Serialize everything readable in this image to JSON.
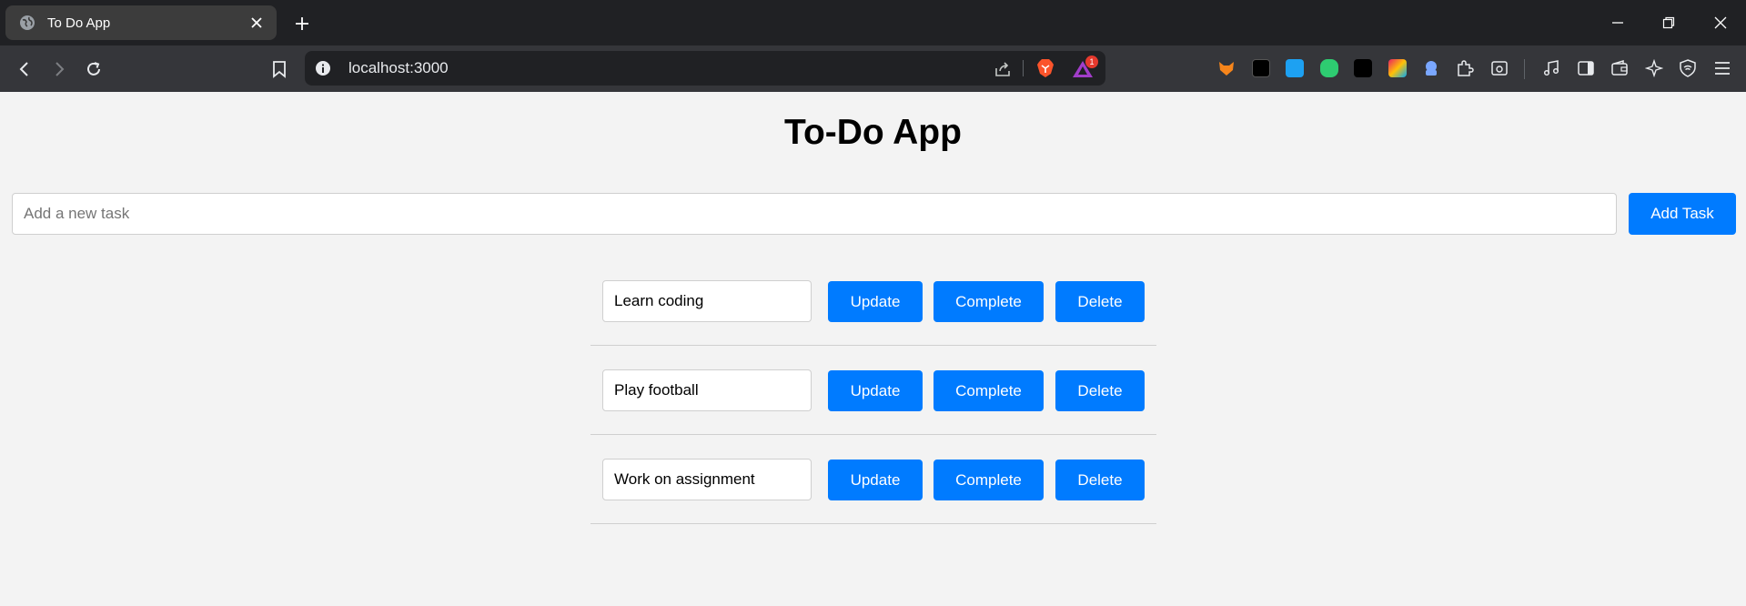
{
  "browser": {
    "tab_title": "To Do App",
    "url": "localhost:3000",
    "rewards_badge": "1",
    "icons": [
      "globe-icon",
      "close-icon",
      "plus-icon",
      "back-icon",
      "forward-icon",
      "reload-icon",
      "bookmark-icon",
      "info-icon",
      "share-icon",
      "brave-shield-icon",
      "brave-rewards-icon",
      "minimize-icon",
      "restore-icon",
      "window-close-icon",
      "extensions-puzzle-icon",
      "media-icon",
      "sidebar-icon",
      "wallet-icon",
      "leo-ai-icon",
      "vpn-icon",
      "menu-icon"
    ],
    "colors": {
      "tabstrip": "#202124",
      "toolbar": "#35363a",
      "omnibox": "#202124"
    }
  },
  "app": {
    "title": "To-Do App",
    "new_task": {
      "value": "",
      "placeholder": "Add a new task"
    },
    "add_button": "Add Task",
    "tasks": [
      {
        "text": "Learn coding",
        "update": "Update",
        "complete": "Complete",
        "delete": "Delete"
      },
      {
        "text": "Play football",
        "update": "Update",
        "complete": "Complete",
        "delete": "Delete"
      },
      {
        "text": "Work on assignment",
        "update": "Update",
        "complete": "Complete",
        "delete": "Delete"
      }
    ],
    "colors": {
      "background": "#f3f3f3",
      "primary": "#007bff",
      "button_text": "#ffffff"
    }
  }
}
